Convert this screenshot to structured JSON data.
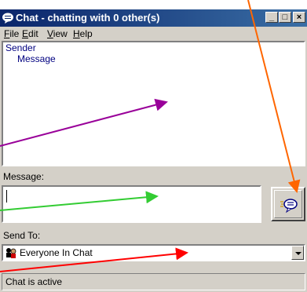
{
  "window": {
    "title": "Chat - chatting with 0 other(s)",
    "minimize_glyph": "_",
    "maximize_glyph": "□",
    "close_glyph": "×"
  },
  "menu": {
    "items": [
      {
        "hotkey": "F",
        "rest": "ile"
      },
      {
        "hotkey": "E",
        "rest": "dit"
      },
      {
        "hotkey": "V",
        "rest": "iew"
      },
      {
        "hotkey": "H",
        "rest": "elp"
      }
    ]
  },
  "history": {
    "sender_label": "Sender",
    "message_label": "Message"
  },
  "message": {
    "label": "Message:",
    "value": ""
  },
  "send_to": {
    "label": "Send To:",
    "selected": "Everyone In Chat"
  },
  "status": {
    "text": "Chat is active"
  },
  "annotations": {
    "colors": {
      "orange": "#ff6600",
      "purple": "#990099",
      "green": "#33cc33",
      "red": "#ff0000"
    }
  }
}
